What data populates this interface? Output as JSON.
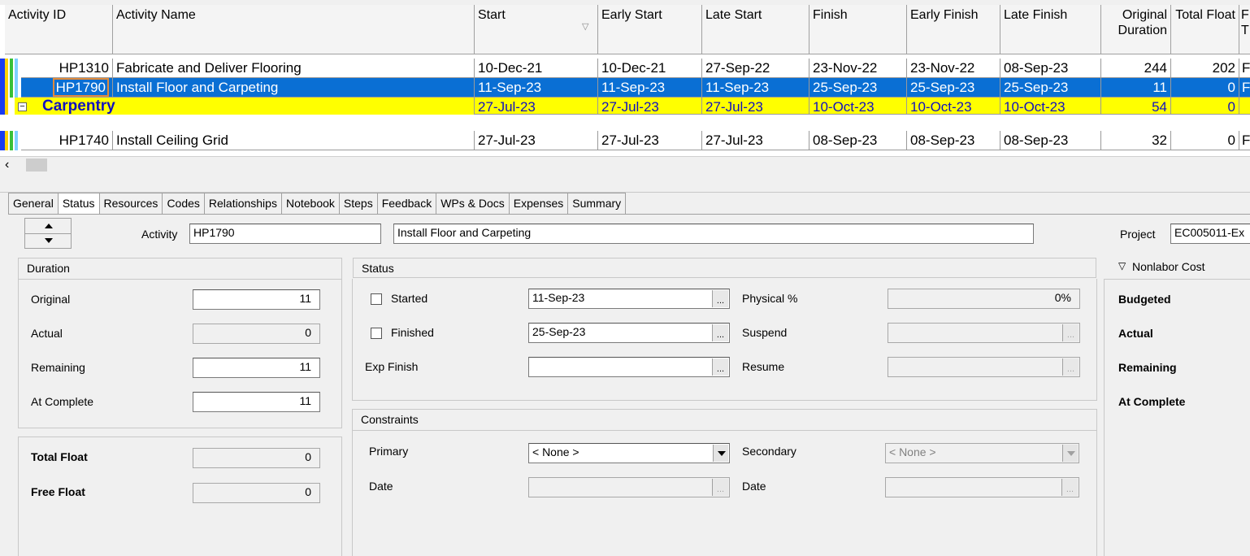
{
  "grid": {
    "columns": [
      {
        "key": "id",
        "label": "Activity ID"
      },
      {
        "key": "name",
        "label": "Activity Name"
      },
      {
        "key": "start",
        "label": "Start"
      },
      {
        "key": "early_start",
        "label": "Early Start"
      },
      {
        "key": "late_start",
        "label": "Late Start"
      },
      {
        "key": "finish",
        "label": "Finish"
      },
      {
        "key": "early_finish",
        "label": "Early Finish"
      },
      {
        "key": "late_finish",
        "label": "Late Finish"
      },
      {
        "key": "orig_dur",
        "label": "Original Duration"
      },
      {
        "key": "total_float",
        "label": "Total Float"
      }
    ],
    "rows": [
      {
        "id": "HP1310",
        "name": "Fabricate and Deliver Flooring",
        "start": "10-Dec-21",
        "early_start": "10-Dec-21",
        "late_start": "27-Sep-22",
        "finish": "23-Nov-22",
        "early_finish": "23-Nov-22",
        "late_finish": "08-Sep-23",
        "orig_dur": "244",
        "total_float": "202",
        "extra": "F"
      },
      {
        "id": "HP1790",
        "name": "Install Floor and Carpeting",
        "start": "11-Sep-23",
        "early_start": "11-Sep-23",
        "late_start": "11-Sep-23",
        "finish": "25-Sep-23",
        "early_finish": "25-Sep-23",
        "late_finish": "25-Sep-23",
        "orig_dur": "11",
        "total_float": "0",
        "extra": "F"
      },
      {
        "wbs": "Carpentry",
        "start": "27-Jul-23",
        "early_start": "27-Jul-23",
        "late_start": "27-Jul-23",
        "finish": "10-Oct-23",
        "early_finish": "10-Oct-23",
        "late_finish": "10-Oct-23",
        "orig_dur": "54",
        "total_float": "0",
        "extra": ""
      },
      {
        "id": "HP1740",
        "name": "Install Ceiling Grid",
        "start": "27-Jul-23",
        "early_start": "27-Jul-23",
        "late_start": "27-Jul-23",
        "finish": "08-Sep-23",
        "early_finish": "08-Sep-23",
        "late_finish": "08-Sep-23",
        "orig_dur": "32",
        "total_float": "0",
        "extra": "F"
      }
    ],
    "extra_header": "F T"
  },
  "tabs": [
    "General",
    "Status",
    "Resources",
    "Codes",
    "Relationships",
    "Notebook",
    "Steps",
    "Feedback",
    "WPs & Docs",
    "Expenses",
    "Summary"
  ],
  "active_tab": "Status",
  "activity": {
    "label": "Activity",
    "id": "HP1790",
    "name": "Install Floor and Carpeting",
    "project_label": "Project",
    "project": "EC005011-Ex"
  },
  "duration": {
    "title": "Duration",
    "original_label": "Original",
    "original": "11",
    "actual_label": "Actual",
    "actual": "0",
    "remaining_label": "Remaining",
    "remaining": "11",
    "at_complete_label": "At Complete",
    "at_complete": "11",
    "total_float_label": "Total Float",
    "total_float": "0",
    "free_float_label": "Free Float",
    "free_float": "0"
  },
  "status": {
    "title": "Status",
    "started_label": "Started",
    "started_date": "11-Sep-23",
    "finished_label": "Finished",
    "finished_date": "25-Sep-23",
    "exp_finish_label": "Exp Finish",
    "exp_finish": "",
    "physical_label": "Physical %",
    "physical": "0%",
    "suspend_label": "Suspend",
    "suspend": "",
    "resume_label": "Resume",
    "resume": ""
  },
  "constraints": {
    "title": "Constraints",
    "primary_label": "Primary",
    "primary": "< None >",
    "date_label": "Date",
    "date": "",
    "secondary_label": "Secondary",
    "secondary": "< None >",
    "date2_label": "Date",
    "date2": ""
  },
  "nonlabor": {
    "title": "Nonlabor Cost",
    "budgeted_label": "Budgeted",
    "actual_label": "Actual",
    "remaining_label": "Remaining",
    "at_complete_label": "At Complete"
  },
  "colors": {
    "selected": "#0a6fd4",
    "wbs": "#ffff00",
    "wbs_text": "#1010c0"
  }
}
